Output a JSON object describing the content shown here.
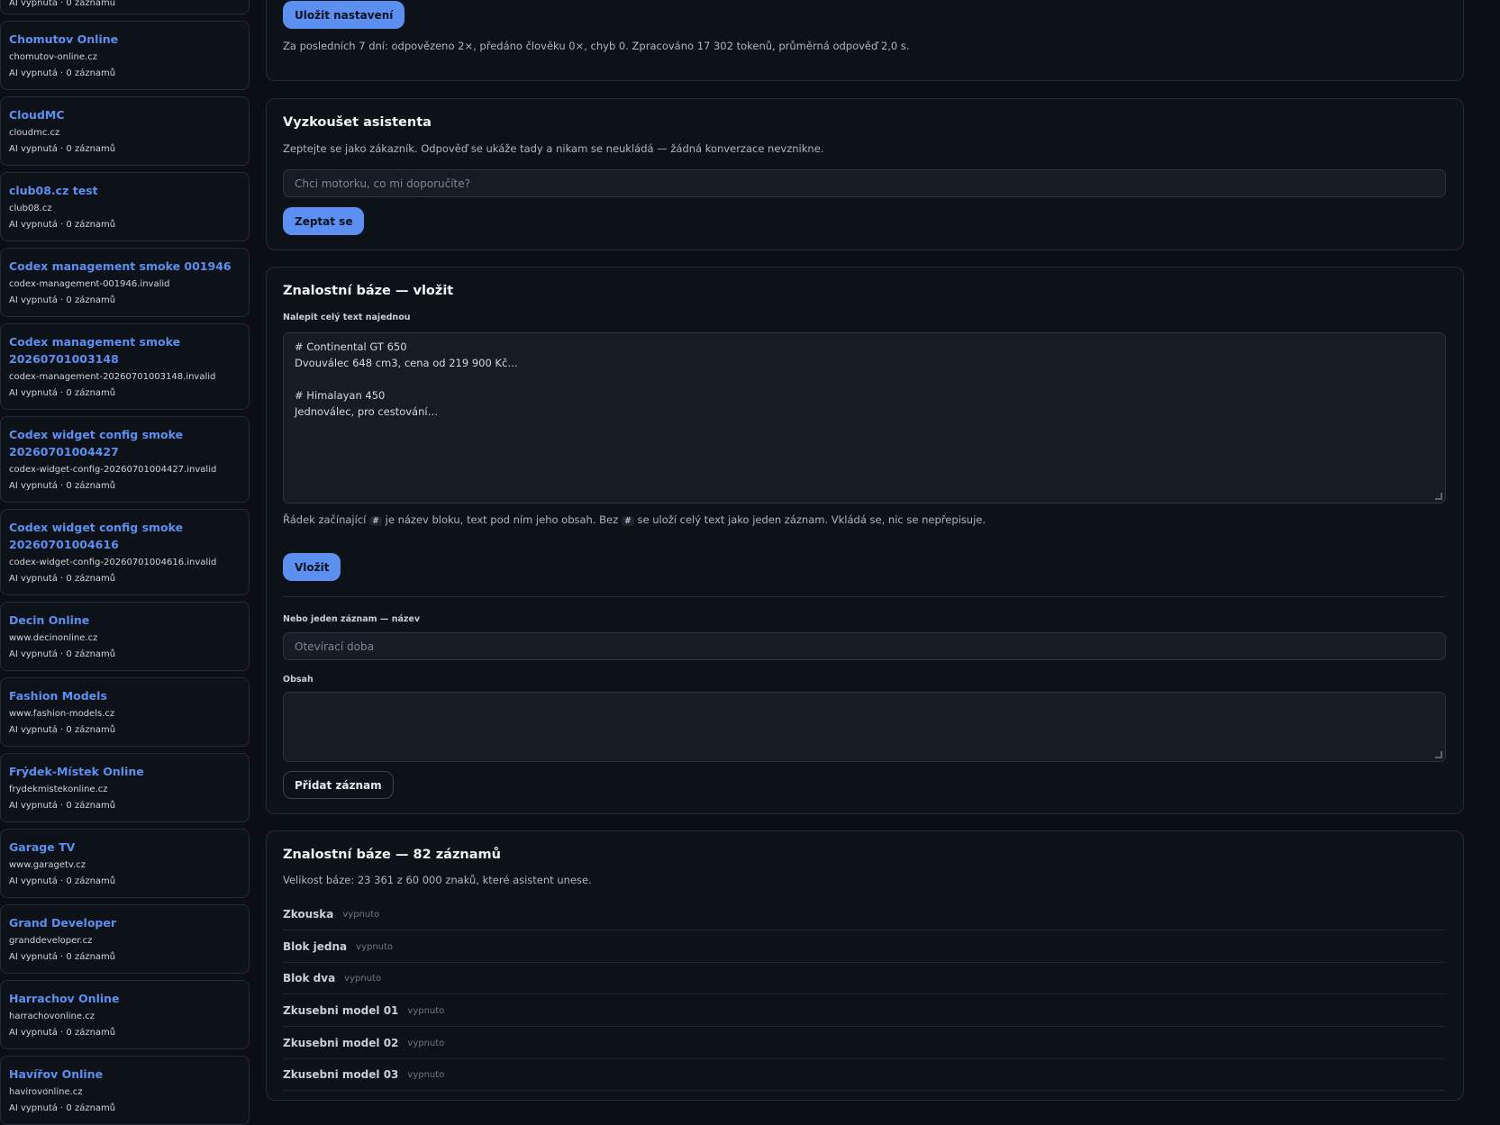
{
  "sidebar": {
    "partial_top_meta": "AI vypnutá · 0 záznamů",
    "sites": [
      {
        "name": "Chomutov Online",
        "domain": "chomutov-online.cz",
        "meta": "AI vypnutá · 0 záznamů"
      },
      {
        "name": "CloudMC",
        "domain": "cloudmc.cz",
        "meta": "AI vypnutá · 0 záznamů"
      },
      {
        "name": "club08.cz test",
        "domain": "club08.cz",
        "meta": "AI vypnutá · 0 záznamů"
      },
      {
        "name": "Codex management smoke 001946",
        "domain": "codex-management-001946.invalid",
        "meta": "AI vypnutá · 0 záznamů"
      },
      {
        "name": "Codex management smoke 20260701003148",
        "domain": "codex-management-20260701003148.invalid",
        "meta": "AI vypnutá · 0 záznamů"
      },
      {
        "name": "Codex widget config smoke 20260701004427",
        "domain": "codex-widget-config-20260701004427.invalid",
        "meta": "AI vypnutá · 0 záznamů"
      },
      {
        "name": "Codex widget config smoke 20260701004616",
        "domain": "codex-widget-config-20260701004616.invalid",
        "meta": "AI vypnutá · 0 záznamů"
      },
      {
        "name": "Decin Online",
        "domain": "www.decinonline.cz",
        "meta": "AI vypnutá · 0 záznamů"
      },
      {
        "name": "Fashion Models",
        "domain": "www.fashion-models.cz",
        "meta": "AI vypnutá · 0 záznamů"
      },
      {
        "name": "Frýdek-Místek Online",
        "domain": "frydekmistekonline.cz",
        "meta": "AI vypnutá · 0 záznamů"
      },
      {
        "name": "Garage TV",
        "domain": "www.garagetv.cz",
        "meta": "AI vypnutá · 0 záznamů"
      },
      {
        "name": "Grand Developer",
        "domain": "granddeveloper.cz",
        "meta": "AI vypnutá · 0 záznamů"
      },
      {
        "name": "Harrachov Online",
        "domain": "harrachovonline.cz",
        "meta": "AI vypnutá · 0 záznamů"
      },
      {
        "name": "Havířov Online",
        "domain": "havirovonline.cz",
        "meta": "AI vypnutá · 0 záznamů"
      }
    ]
  },
  "settings": {
    "save_label": "Uložit nastavení",
    "stats": "Za posledních 7 dní: odpovězeno 2×, předáno člověku 0×, chyb 0. Zpracováno 17 302 tokenů, průměrná odpověď 2,0 s."
  },
  "try_assistant": {
    "title": "Vyzkoušet asistenta",
    "description": "Zeptejte se jako zákazník. Odpověď se ukáže tady a nikam se neukládá — žádná konverzace nevznikne.",
    "placeholder": "Chci motorku, co mi doporučíte?",
    "ask_label": "Zeptat se"
  },
  "kb_insert": {
    "title": "Znalostní báze — vložit",
    "paste_label": "Nalepit celý text najednou",
    "paste_value": "# Continental GT 650\nDvouválec 648 cm3, cena od 219 900 Kč…\n\n# Himalayan 450\nJednoválec, pro cestování…",
    "hint_before": "Řádek začínající",
    "hint_chip": "#",
    "hint_middle": "je název bloku, text pod ním jeho obsah. Bez",
    "hint_after": "se uloží celý text jako jeden záznam. Vkládá se, nic se nepřepisuje.",
    "insert_label": "Vložit",
    "single_name_label": "Nebo jeden záznam — název",
    "single_name_placeholder": "Otevírací doba",
    "content_label": "Obsah",
    "add_label": "Přidat záznam"
  },
  "kb_list": {
    "title": "Znalostní báze — 82 záznamů",
    "size": "Velikost báze: 23 361 z 60 000 znaků, které asistent unese.",
    "entries": [
      {
        "name": "Zkouska",
        "state": "vypnuto"
      },
      {
        "name": "Blok jedna",
        "state": "vypnuto"
      },
      {
        "name": "Blok dva",
        "state": "vypnuto"
      },
      {
        "name": "Zkusebni model 01",
        "state": "vypnuto"
      },
      {
        "name": "Zkusebni model 02",
        "state": "vypnuto"
      },
      {
        "name": "Zkusebni model 03",
        "state": "vypnuto"
      }
    ]
  }
}
